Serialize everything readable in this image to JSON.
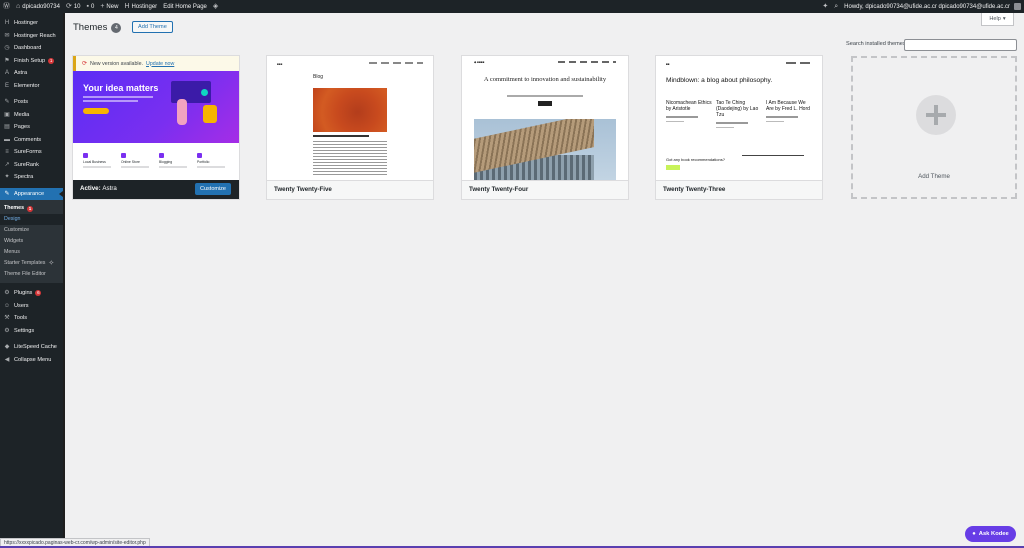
{
  "adminbar": {
    "site_name": "dpicado90734",
    "updates_count": "10",
    "comments_count": "0",
    "new_label": "New",
    "hostinger_label": "Hostinger",
    "edit_home_label": "Edit Home Page",
    "howdy_label": "Howdy, dpicado90734@ufide.ac.cr dpicado90734@ufide.ac.cr"
  },
  "sidebar": {
    "items_top": [
      {
        "label": "Hostinger",
        "icon": "hostinger-icon"
      },
      {
        "label": "Hostinger Reach",
        "icon": "reach-icon"
      },
      {
        "label": "Dashboard",
        "icon": "dashboard-icon"
      },
      {
        "label": "Finish Setup",
        "icon": "setup-icon",
        "badge": "1"
      },
      {
        "label": "Astra",
        "icon": "astra-icon"
      },
      {
        "label": "Elementor",
        "icon": "elementor-icon"
      }
    ],
    "items_mid": [
      {
        "label": "Posts",
        "icon": "pin-icon"
      },
      {
        "label": "Media",
        "icon": "media-icon"
      },
      {
        "label": "Pages",
        "icon": "pages-icon"
      },
      {
        "label": "Comments",
        "icon": "comments-icon"
      },
      {
        "label": "SureForms",
        "icon": "forms-icon"
      },
      {
        "label": "SureRank",
        "icon": "rank-icon"
      },
      {
        "label": "Spectra",
        "icon": "spectra-icon"
      }
    ],
    "appearance": {
      "label": "Appearance",
      "icon": "brush-icon"
    },
    "submenu": [
      {
        "label": "Themes",
        "badge": "1"
      },
      {
        "label": "Design"
      },
      {
        "label": "Customize"
      },
      {
        "label": "Widgets"
      },
      {
        "label": "Menus"
      },
      {
        "label": "Starter Templates"
      },
      {
        "label": "Theme File Editor"
      }
    ],
    "items_bottom": [
      {
        "label": "Plugins",
        "icon": "plugin-icon",
        "badge": "6"
      },
      {
        "label": "Users",
        "icon": "users-icon"
      },
      {
        "label": "Tools",
        "icon": "tools-icon"
      },
      {
        "label": "Settings",
        "icon": "settings-icon"
      }
    ],
    "items_extra": [
      {
        "label": "LiteSpeed Cache",
        "icon": "litespeed-icon"
      },
      {
        "label": "Collapse Menu",
        "icon": "collapse-icon"
      }
    ]
  },
  "main": {
    "title": "Themes",
    "count": "4",
    "add_button": "Add Theme",
    "help_label": "Help",
    "search_label": "Search installed themes",
    "search_value": ""
  },
  "themes": [
    {
      "name": "Astra",
      "active_prefix": "Active:",
      "customize_label": "Customize",
      "notice_text": "New version available.",
      "notice_link": "Update now",
      "hero_heading": "Your idea matters",
      "features": [
        "Local Business",
        "Online Store",
        "Blogging",
        "Portfolio"
      ]
    },
    {
      "name": "Twenty Twenty-Five",
      "preview_title": "Blog"
    },
    {
      "name": "Twenty Twenty-Four",
      "preview_heading": "A commitment to innovation and sustainability"
    },
    {
      "name": "Twenty Twenty-Three",
      "preview_heading": "Mindblown: a blog about philosophy.",
      "posts": [
        "Nicomachean Ethics by Aristotle",
        "Tao Te Ching (Daodejing) by Lao Tzu",
        "I Am Because We Are by Fred L. Hord"
      ],
      "question": "Got any book recommendations?"
    }
  ],
  "add_theme_card": {
    "label": "Add Theme"
  },
  "kodee": {
    "label": "Ask Kodee"
  },
  "statusbar": {
    "url": "https://xxxxpicado.paginas-web-cr.com/wp-admin/site-editor.php"
  },
  "colors": {
    "admin_dark": "#1d2327",
    "accent": "#2271b1",
    "badge": "#d63638",
    "kodee": "#673de6"
  }
}
